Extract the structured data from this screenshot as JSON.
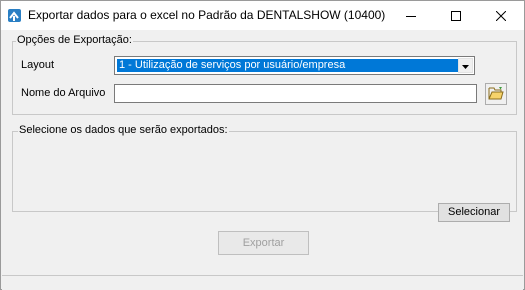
{
  "window": {
    "title": "Exportar dados para o excel no Padrão da DENTALSHOW (10400)",
    "icon": "app-arrow-icon",
    "controls": [
      "minimize-icon",
      "maximize-icon",
      "close-icon"
    ]
  },
  "export_options": {
    "group_label": "Opções de Exportação:",
    "layout_label": "Layout",
    "layout_selected": "1 - Utilização de serviços por usuário/empresa",
    "filename_label": "Nome do Arquivo",
    "filename_value": "",
    "browse_icon": "folder-open-icon"
  },
  "data_selection": {
    "group_label": "Selecione os dados que serão exportados:",
    "select_button": "Selecionar"
  },
  "actions": {
    "export_button": "Exportar",
    "export_enabled": false
  },
  "colors": {
    "selection": "#0078d7",
    "window_bg": "#f0f0f0"
  }
}
